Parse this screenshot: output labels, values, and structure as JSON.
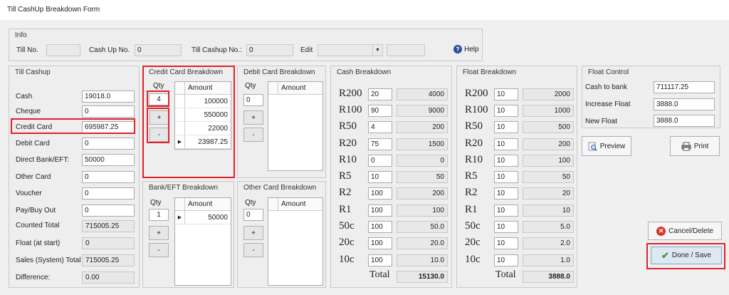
{
  "window": {
    "title": "Till CashUp Breakdown Form"
  },
  "info": {
    "title": "Info",
    "till_no_label": "Till No.",
    "till_no_value": "",
    "cashup_no_label": "Cash Up No.",
    "cashup_no_value": "0",
    "till_cashup_no_label": "Till Cashup No.:",
    "till_cashup_no_value": "0",
    "edit_label": "Edit",
    "edit_value": "",
    "help_label": "Help"
  },
  "till_cashup": {
    "title": "Till Cashup",
    "rows": [
      {
        "label": "Cash",
        "value": "19018.0"
      },
      {
        "label": "Cheque",
        "value": "0"
      },
      {
        "label": "Credit Card",
        "value": "695987.25"
      },
      {
        "label": "Debit Card",
        "value": "0"
      },
      {
        "label": "Direct Bank/EFT:",
        "value": "50000"
      },
      {
        "label": "Other Card",
        "value": "0"
      },
      {
        "label": "Voucher",
        "value": "0"
      },
      {
        "label": "Pay/Buy Out",
        "value": "0"
      }
    ],
    "counted_total_label": "Counted Total",
    "counted_total_value": "715005.25",
    "float_start_label": "Float (at start)",
    "float_start_value": "0",
    "sales_total_label": "Sales (System) Total",
    "sales_total_value": "715005.25",
    "difference_label": "Difference:",
    "difference_value": "0.00"
  },
  "credit_card": {
    "title": "Credit Card Breakdown",
    "qty_label": "Qty",
    "qty_value": "4",
    "amount_label": "Amount",
    "amounts": [
      "100000",
      "550000",
      "22000",
      "23987.25"
    ],
    "plus": "+",
    "minus": "-"
  },
  "debit_card": {
    "title": "Debit Card Breakdown",
    "qty_label": "Qty",
    "qty_value": "0",
    "amount_label": "Amount",
    "plus": "+",
    "minus": "-"
  },
  "bank_eft": {
    "title": "Bank/EFT Breakdown",
    "qty_label": "Qty",
    "qty_value": "1",
    "amount_label": "Amount",
    "amounts": [
      "50000"
    ],
    "plus": "+",
    "minus": "-"
  },
  "other_card": {
    "title": "Other Card Breakdown",
    "qty_label": "Qty",
    "qty_value": "0",
    "amount_label": "Amount",
    "plus": "+",
    "minus": "-"
  },
  "cash_breakdown": {
    "title": "Cash Breakdown",
    "rows": [
      {
        "denom": "R200",
        "qty": "20",
        "total": "4000"
      },
      {
        "denom": "R100",
        "qty": "90",
        "total": "9000"
      },
      {
        "denom": "R50",
        "qty": "4",
        "total": "200"
      },
      {
        "denom": "R20",
        "qty": "75",
        "total": "1500"
      },
      {
        "denom": "R10",
        "qty": "0",
        "total": "0"
      },
      {
        "denom": "R5",
        "qty": "10",
        "total": "50"
      },
      {
        "denom": "R2",
        "qty": "100",
        "total": "200"
      },
      {
        "denom": "R1",
        "qty": "100",
        "total": "100"
      },
      {
        "denom": "50c",
        "qty": "100",
        "total": "50.0"
      },
      {
        "denom": "20c",
        "qty": "100",
        "total": "20.0"
      },
      {
        "denom": "10c",
        "qty": "100",
        "total": "10.0"
      }
    ],
    "total_label": "Total",
    "total_value": "15130.0"
  },
  "float_breakdown": {
    "title": "Float Breakdown",
    "rows": [
      {
        "denom": "R200",
        "qty": "10",
        "total": "2000"
      },
      {
        "denom": "R100",
        "qty": "10",
        "total": "1000"
      },
      {
        "denom": "R50",
        "qty": "10",
        "total": "500"
      },
      {
        "denom": "R20",
        "qty": "10",
        "total": "200"
      },
      {
        "denom": "R10",
        "qty": "10",
        "total": "100"
      },
      {
        "denom": "R5",
        "qty": "10",
        "total": "50"
      },
      {
        "denom": "R2",
        "qty": "10",
        "total": "20"
      },
      {
        "denom": "R1",
        "qty": "10",
        "total": "10"
      },
      {
        "denom": "50c",
        "qty": "10",
        "total": "5.0"
      },
      {
        "denom": "20c",
        "qty": "10",
        "total": "2.0"
      },
      {
        "denom": "10c",
        "qty": "10",
        "total": "1.0"
      }
    ],
    "total_label": "Total",
    "total_value": "3888.0"
  },
  "float_control": {
    "title": "Float Control",
    "cash_to_bank_label": "Cash to bank",
    "cash_to_bank_value": "711117.25",
    "increase_float_label": "Increase Float",
    "increase_float_value": "3888.0",
    "new_float_label": "New Float",
    "new_float_value": "3888.0"
  },
  "buttons": {
    "preview": "Preview",
    "print": "Print",
    "cancel_delete": "Cancel/Delete",
    "done_save": "Done / Save"
  },
  "colors": {
    "highlight": "#e0222a",
    "help": "#2b4c9a",
    "cancel": "#d9342b",
    "done": "#3a9a3a"
  }
}
